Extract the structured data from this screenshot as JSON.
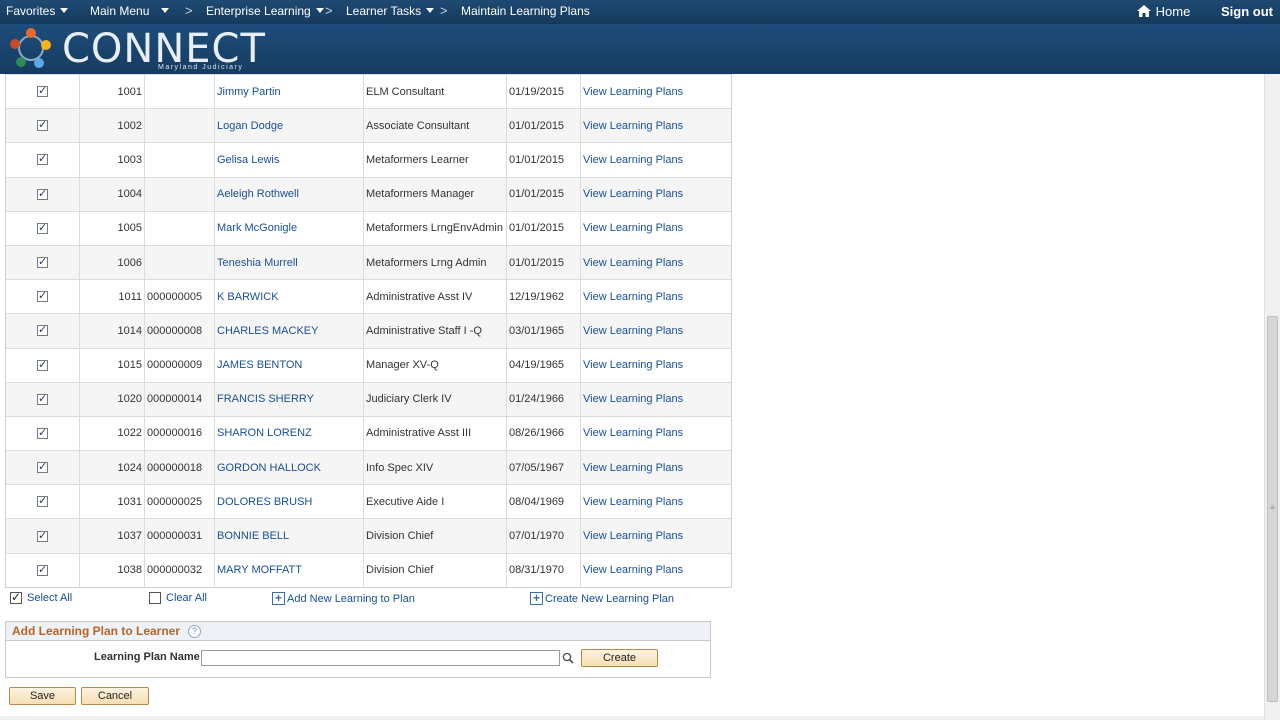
{
  "nav": {
    "favorites": "Favorites",
    "main_menu": "Main Menu",
    "enterprise_learning": "Enterprise Learning",
    "learner_tasks": "Learner Tasks",
    "current_page": "Maintain Learning Plans",
    "separator": ">",
    "home": "Home",
    "sign_out": "Sign out"
  },
  "brand": {
    "name": "CONNECT",
    "subtitle": "Maryland Judiciary"
  },
  "rows": [
    {
      "checked": true,
      "id": "1001",
      "emp": "",
      "name": "Jimmy Partin",
      "title": "ELM Consultant",
      "date": "01/19/2015",
      "link": "View Learning Plans"
    },
    {
      "checked": true,
      "id": "1002",
      "emp": "",
      "name": "Logan Dodge",
      "title": "Associate Consultant",
      "date": "01/01/2015",
      "link": "View Learning Plans"
    },
    {
      "checked": true,
      "id": "1003",
      "emp": "",
      "name": "Gelisa Lewis",
      "title": "Metaformers Learner",
      "date": "01/01/2015",
      "link": "View Learning Plans"
    },
    {
      "checked": true,
      "id": "1004",
      "emp": "",
      "name": "Aeleigh Rothwell",
      "title": "Metaformers Manager",
      "date": "01/01/2015",
      "link": "View Learning Plans"
    },
    {
      "checked": true,
      "id": "1005",
      "emp": "",
      "name": "Mark McGonigle",
      "title": "Metaformers LrngEnvAdmin",
      "date": "01/01/2015",
      "link": "View Learning Plans"
    },
    {
      "checked": true,
      "id": "1006",
      "emp": "",
      "name": "Teneshia Murrell",
      "title": "Metaformers Lrng Admin",
      "date": "01/01/2015",
      "link": "View Learning Plans"
    },
    {
      "checked": true,
      "id": "1011",
      "emp": "000000005",
      "name": "K BARWICK",
      "title": "Administrative Asst IV",
      "date": "12/19/1962",
      "link": "View Learning Plans"
    },
    {
      "checked": true,
      "id": "1014",
      "emp": "000000008",
      "name": "CHARLES MACKEY",
      "title": "Administrative Staff I -Q",
      "date": "03/01/1965",
      "link": "View Learning Plans"
    },
    {
      "checked": true,
      "id": "1015",
      "emp": "000000009",
      "name": "JAMES BENTON",
      "title": "Manager XV-Q",
      "date": "04/19/1965",
      "link": "View Learning Plans"
    },
    {
      "checked": true,
      "id": "1020",
      "emp": "000000014",
      "name": "FRANCIS SHERRY",
      "title": "Judiciary Clerk IV",
      "date": "01/24/1966",
      "link": "View Learning Plans"
    },
    {
      "checked": true,
      "id": "1022",
      "emp": "000000016",
      "name": "SHARON LORENZ",
      "title": "Administrative Asst III",
      "date": "08/26/1966",
      "link": "View Learning Plans"
    },
    {
      "checked": true,
      "id": "1024",
      "emp": "000000018",
      "name": "GORDON HALLOCK",
      "title": "Info Spec XIV",
      "date": "07/05/1967",
      "link": "View Learning Plans"
    },
    {
      "checked": true,
      "id": "1031",
      "emp": "000000025",
      "name": "DOLORES BRUSH",
      "title": "Executive Aide I",
      "date": "08/04/1969",
      "link": "View Learning Plans"
    },
    {
      "checked": true,
      "id": "1037",
      "emp": "000000031",
      "name": "BONNIE BELL",
      "title": "Division Chief",
      "date": "07/01/1970",
      "link": "View Learning Plans"
    },
    {
      "checked": true,
      "id": "1038",
      "emp": "000000032",
      "name": "MARY MOFFATT",
      "title": "Division Chief",
      "date": "08/31/1970",
      "link": "View Learning Plans"
    }
  ],
  "actions": {
    "select_all": "Select All",
    "clear_all": "Clear All",
    "add_new_learning": "Add New Learning to Plan",
    "create_new_plan": "Create New Learning Plan"
  },
  "add_plan": {
    "heading": "Add Learning Plan to Learner",
    "help": "?",
    "field_label": "Learning Plan Name",
    "field_value": "",
    "create_label": "Create"
  },
  "footer": {
    "save_label": "Save",
    "cancel_label": "Cancel"
  },
  "colors": {
    "nav_bg": "#15395c",
    "link": "#1a4f95",
    "heading_accent": "#b5652b",
    "button_bg": "#f6dfb4"
  }
}
